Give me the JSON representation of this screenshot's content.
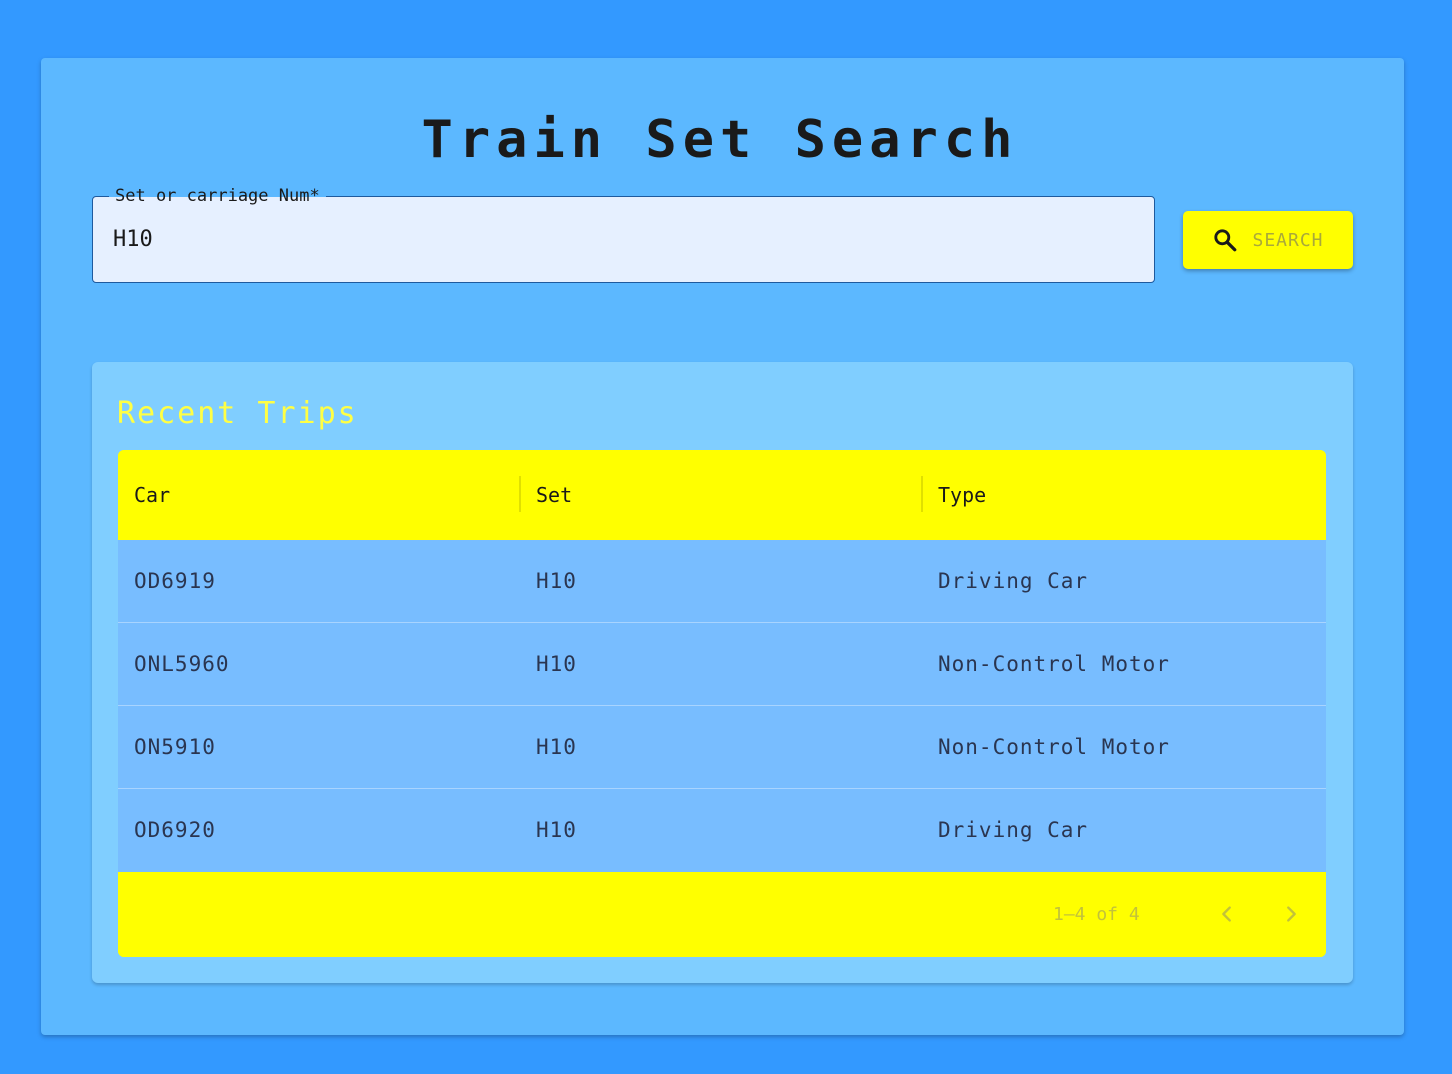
{
  "page": {
    "title": "Train Set Search"
  },
  "search": {
    "label": "Set or carriage Num*",
    "value": "H10",
    "button_label": "SEARCH",
    "button_icon": "search-icon"
  },
  "recent_trips": {
    "title": "Recent Trips",
    "columns": [
      "Car",
      "Set",
      "Type"
    ],
    "rows": [
      {
        "car": "OD6919",
        "set": "H10",
        "type": "Driving Car"
      },
      {
        "car": "ONL5960",
        "set": "H10",
        "type": "Non-Control Motor"
      },
      {
        "car": "ON5910",
        "set": "H10",
        "type": "Non-Control Motor"
      },
      {
        "car": "OD6920",
        "set": "H10",
        "type": "Driving Car"
      }
    ],
    "pagination": {
      "info": "1–4 of 4",
      "prev_icon": "chevron-left-icon",
      "next_icon": "chevron-right-icon"
    }
  },
  "colors": {
    "background": "#3399ff",
    "card": "#5cb8ff",
    "inner_card": "#80ceff",
    "accent": "#ffff00",
    "row": "#78bdff",
    "section_title": "#ffff44"
  }
}
